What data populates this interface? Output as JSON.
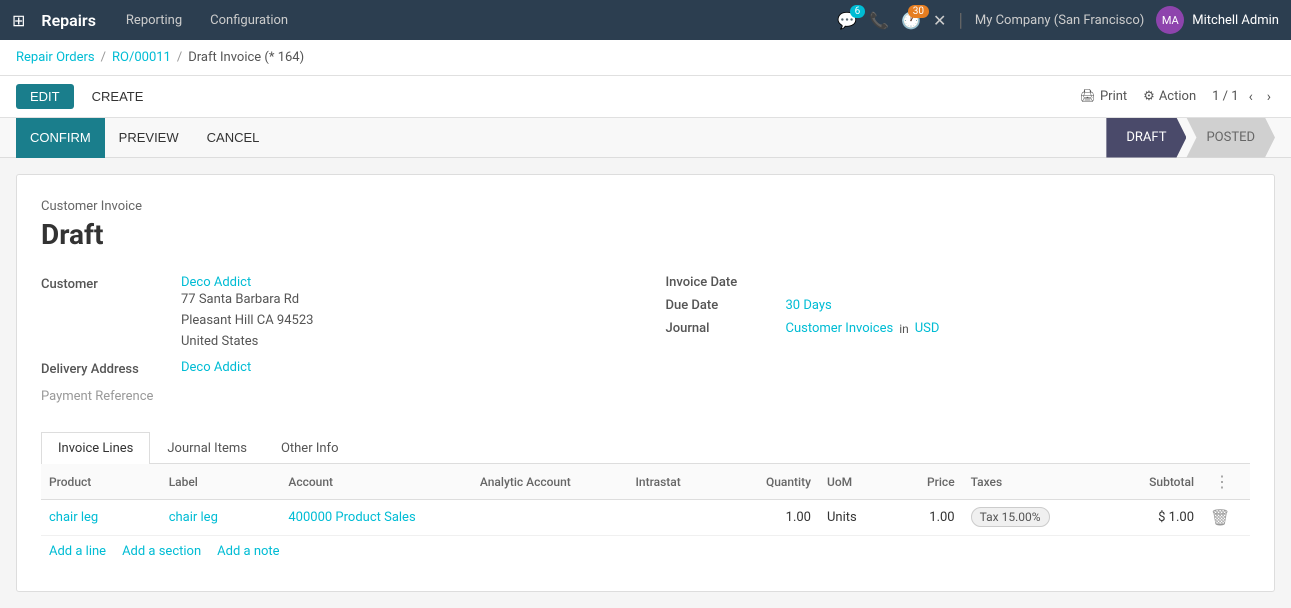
{
  "topnav": {
    "grid_icon": "⊞",
    "app_name": "Repairs",
    "links": [
      {
        "label": "Reporting",
        "id": "reporting"
      },
      {
        "label": "Configuration",
        "id": "configuration"
      }
    ],
    "message_count": "6",
    "activity_count": "30",
    "company": "My Company (San Francisco)",
    "user": "Mitchell Admin"
  },
  "breadcrumb": {
    "parts": [
      {
        "label": "Repair Orders",
        "link": true
      },
      {
        "label": "RO/00011",
        "link": true
      },
      {
        "label": "Draft Invoice (* 164)",
        "link": false
      }
    ]
  },
  "toolbar": {
    "edit_label": "EDIT",
    "create_label": "CREATE",
    "print_label": "Print",
    "action_label": "Action",
    "pagination": "1 / 1"
  },
  "statusbar": {
    "confirm_label": "CONFIRM",
    "preview_label": "PREVIEW",
    "cancel_label": "CANCEL",
    "statuses": [
      {
        "label": "DRAFT",
        "active": true
      },
      {
        "label": "POSTED",
        "active": false
      }
    ]
  },
  "invoice": {
    "type_label": "Customer Invoice",
    "status_title": "Draft",
    "customer_label": "Customer",
    "customer_name": "Deco Addict",
    "customer_address_line1": "77 Santa Barbara Rd",
    "customer_address_line2": "Pleasant Hill CA 94523",
    "customer_address_line3": "United States",
    "delivery_address_label": "Delivery Address",
    "delivery_address_value": "Deco Addict",
    "payment_reference_label": "Payment Reference",
    "invoice_date_label": "Invoice Date",
    "invoice_date_value": "",
    "due_date_label": "Due Date",
    "due_date_value": "30 Days",
    "journal_label": "Journal",
    "journal_value": "Customer Invoices",
    "journal_in": "in",
    "journal_currency": "USD"
  },
  "tabs": [
    {
      "label": "Invoice Lines",
      "active": true
    },
    {
      "label": "Journal Items",
      "active": false
    },
    {
      "label": "Other Info",
      "active": false
    }
  ],
  "table": {
    "columns": [
      {
        "label": "Product",
        "key": "product"
      },
      {
        "label": "Label",
        "key": "label"
      },
      {
        "label": "Account",
        "key": "account"
      },
      {
        "label": "Analytic Account",
        "key": "analytic_account"
      },
      {
        "label": "Intrastat",
        "key": "intrastat"
      },
      {
        "label": "Quantity",
        "key": "quantity"
      },
      {
        "label": "UoM",
        "key": "uom"
      },
      {
        "label": "Price",
        "key": "price"
      },
      {
        "label": "Taxes",
        "key": "taxes"
      },
      {
        "label": "Subtotal",
        "key": "subtotal"
      }
    ],
    "rows": [
      {
        "product": "chair leg",
        "label": "chair leg",
        "account": "400000 Product Sales",
        "analytic_account": "",
        "intrastat": "",
        "quantity": "1.00",
        "uom": "Units",
        "price": "1.00",
        "taxes": "Tax 15.00%",
        "subtotal": "$ 1.00"
      }
    ],
    "footer_actions": [
      {
        "label": "Add a line"
      },
      {
        "label": "Add a section"
      },
      {
        "label": "Add a note"
      }
    ]
  }
}
